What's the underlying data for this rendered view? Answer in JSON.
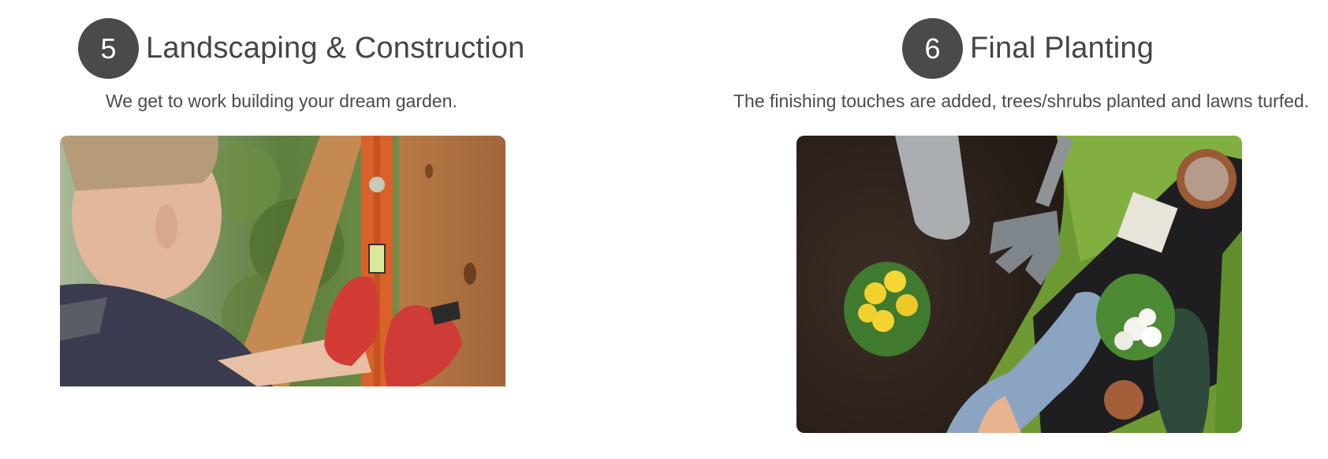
{
  "steps": [
    {
      "number": "5",
      "title": "Landscaping & Construction",
      "description": "We get to work building your dream garden.",
      "image": "man-using-spirit-level-on-timber-frame"
    },
    {
      "number": "6",
      "title": "Final Planting",
      "description": "The finishing touches are added, trees/shrubs planted and lawns turfed.",
      "image": "hands-planting-flowers-with-garden-tools"
    }
  ],
  "colors": {
    "badge_bg": "#4a4a4a",
    "badge_text": "#ffffff",
    "title_text": "#454545",
    "body_text": "#4b4b4b"
  }
}
